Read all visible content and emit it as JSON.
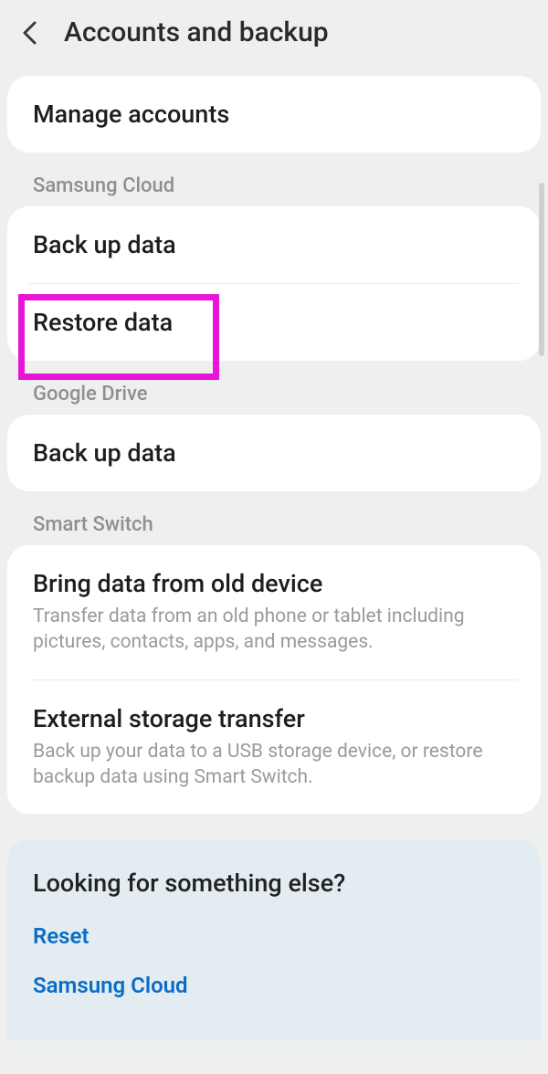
{
  "header": {
    "title": "Accounts and backup"
  },
  "top": {
    "manage_accounts": "Manage accounts"
  },
  "samsung_cloud": {
    "section": "Samsung Cloud",
    "backup": "Back up data",
    "restore": "Restore data"
  },
  "google_drive": {
    "section": "Google Drive",
    "backup": "Back up data"
  },
  "smart_switch": {
    "section": "Smart Switch",
    "bring_title": "Bring data from old device",
    "bring_sub": "Transfer data from an old phone or tablet including pictures, contacts, apps, and messages.",
    "ext_title": "External storage transfer",
    "ext_sub": "Back up your data to a USB storage device, or restore backup data using Smart Switch."
  },
  "footer": {
    "title": "Looking for something else?",
    "reset": "Reset",
    "samsung_cloud": "Samsung Cloud"
  },
  "annotation": {
    "highlight_target": "restore-data-row",
    "highlight_color": "#e815d6"
  }
}
